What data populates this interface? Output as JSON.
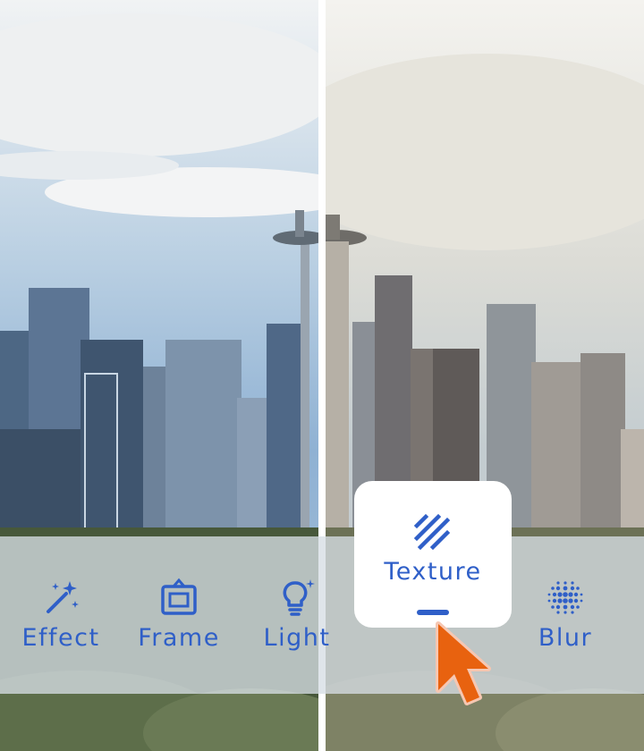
{
  "toolbar": {
    "tools": [
      {
        "label": "Effect",
        "icon": "magic-wand-icon",
        "active": false
      },
      {
        "label": "Frame",
        "icon": "frame-icon",
        "active": false
      },
      {
        "label": "Light",
        "icon": "light-bulb-icon",
        "active": false
      },
      {
        "label": "Texture",
        "icon": "texture-icon",
        "active": true
      },
      {
        "label": "Blur",
        "icon": "blur-dots-icon",
        "active": false
      }
    ]
  },
  "colors": {
    "accent": "#2f5fc8",
    "cursor": "#e8620f"
  }
}
